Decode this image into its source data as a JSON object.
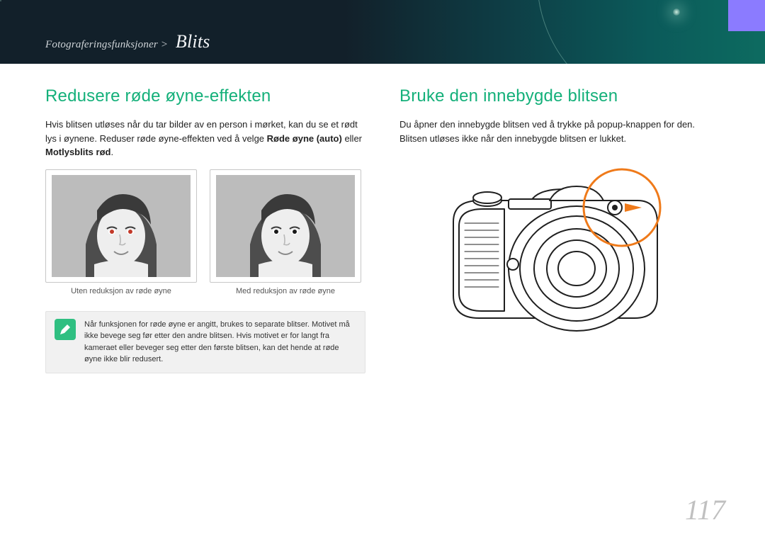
{
  "breadcrumb": {
    "parent": "Fotograferingsfunksjoner >",
    "current": "Blits"
  },
  "left": {
    "heading": "Redusere røde øyne-effekten",
    "body_pre": "Hvis blitsen utløses når du tar bilder av en person i mørket, kan du se et rødt lys i øynene. Reduser røde øyne-effekten ved å velge ",
    "body_bold1": "Røde øyne (auto)",
    "body_mid": " eller ",
    "body_bold2": "Motlysblits rød",
    "body_end": ".",
    "figs": [
      {
        "caption": "Uten reduksjon av røde øyne",
        "eye_color": "#c23a2a"
      },
      {
        "caption": "Med reduksjon av røde øyne",
        "eye_color": "#1a1a1a"
      }
    ],
    "note": "Når funksjonen for røde øyne er angitt, brukes to separate blitser. Motivet må ikke bevege seg før etter den andre blitsen. Hvis motivet er for langt fra kameraet eller beveger seg etter den første blitsen, kan det hende at røde øyne ikke blir redusert."
  },
  "right": {
    "heading": "Bruke den innebygde blitsen",
    "body": "Du åpner den innebygde blitsen ved å trykke på popup-knappen for den. Blitsen utløses ikke når den innebygde blitsen er lukket."
  },
  "page_number": "117"
}
